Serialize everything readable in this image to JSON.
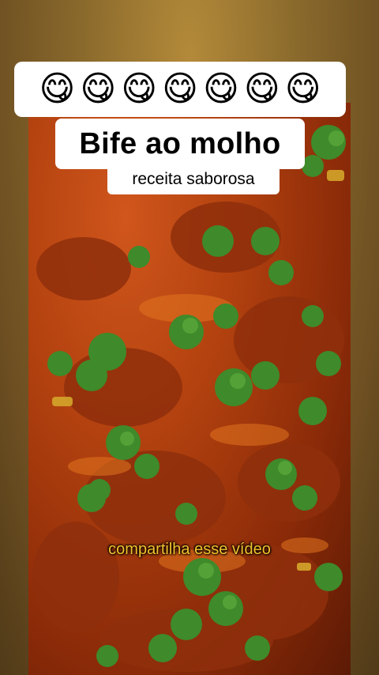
{
  "emoji_banner": {
    "emojis": [
      "😋",
      "😋",
      "😋",
      "😋",
      "😋",
      "😋",
      "😋"
    ]
  },
  "title": "Bife ao molho",
  "subtitle": "receita saborosa",
  "caption": "compartilha esse vídeo",
  "colors": {
    "sauce": "#b2410f",
    "herb": "#3f8a2a",
    "caption_text": "#f3c12d"
  }
}
